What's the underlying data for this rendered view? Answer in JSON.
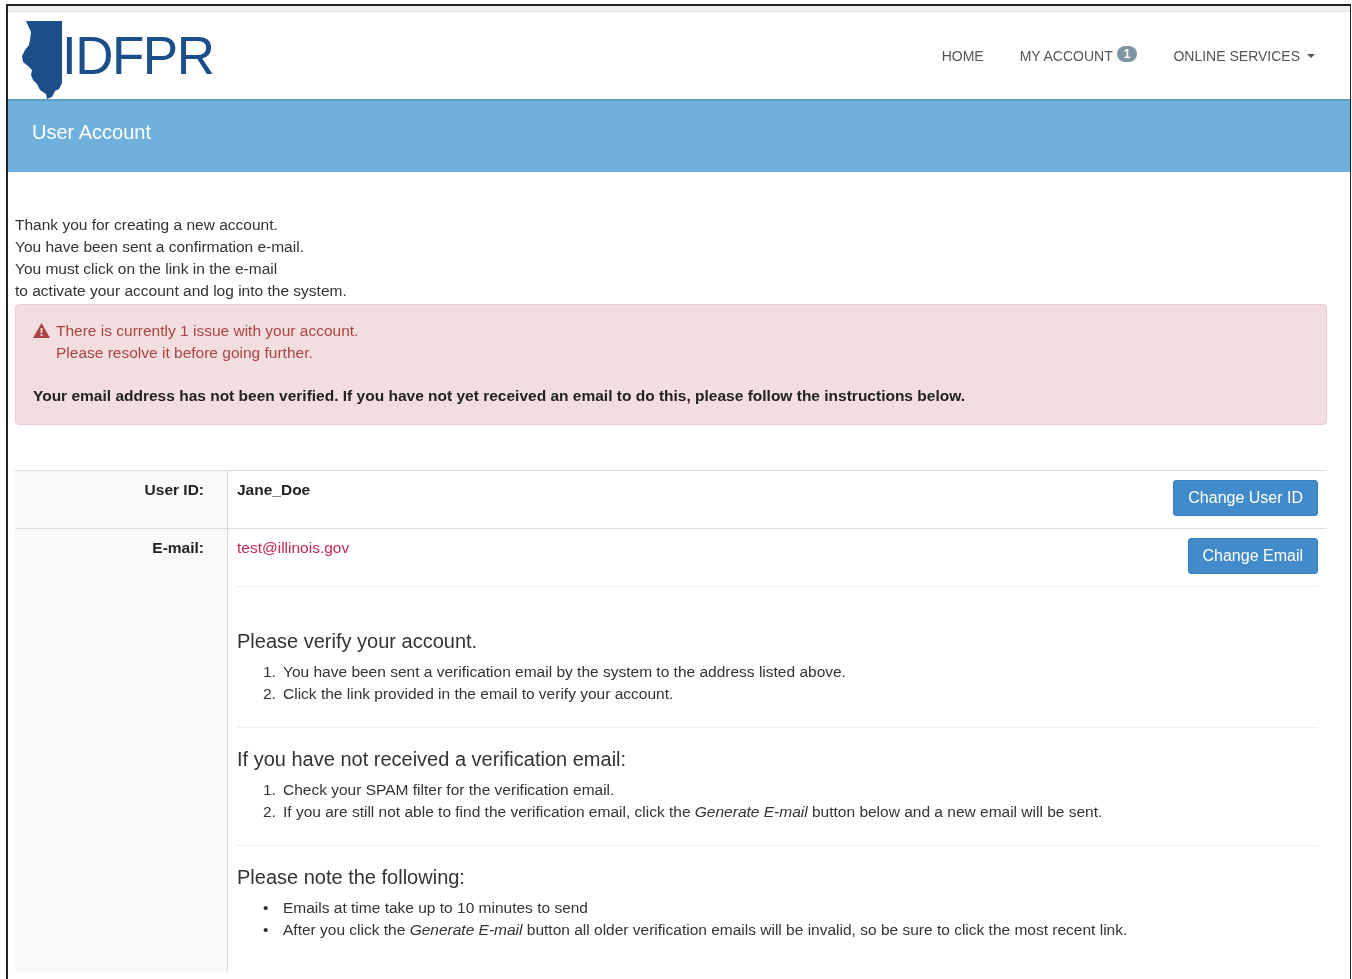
{
  "header": {
    "logo": "IDFPR",
    "nav": [
      {
        "label": "HOME",
        "kind": "link"
      },
      {
        "label": "MY ACCOUNT",
        "kind": "badge",
        "badge": "1"
      },
      {
        "label": "ONLINE SERVICES",
        "kind": "dropdown"
      }
    ]
  },
  "banner": {
    "title": "User Account"
  },
  "intro": [
    "Thank you for creating a new account.",
    "You have been sent a confirmation e-mail.",
    "You must click on the link in the e-mail",
    "to activate your account and log into the system."
  ],
  "alert": {
    "lines": [
      "There is currently 1 issue with your account.",
      "Please resolve it before going further."
    ],
    "message": "Your email address has not been verified. If you have not yet received an email to do this, please follow the instructions below."
  },
  "account": {
    "rows": [
      {
        "label": "User ID:",
        "value": "Jane_Doe",
        "kind": "text",
        "button": "Change User ID"
      },
      {
        "label": "E-mail:",
        "value": "test@illinois.gov",
        "kind": "email",
        "button": "Change Email"
      }
    ]
  },
  "sections": [
    {
      "heading": "Please verify your account.",
      "items": [
        {
          "marker": "1.",
          "text": "You have been sent a verification email by the system to the address listed above."
        },
        {
          "marker": "2.",
          "text": "Click the link provided in the email to verify your account."
        }
      ]
    },
    {
      "heading": "If you have not received a verification email:",
      "items": [
        {
          "marker": "1.",
          "text": "Check your SPAM filter for the verification email."
        },
        {
          "marker": "2.",
          "text": "If you are still not able to find the verification email, click the *Generate E-mail* button below and a new email will be sent."
        }
      ]
    },
    {
      "heading": "Please note the following:",
      "items": [
        {
          "marker": "•",
          "text": "Emails at time take up to 10 minutes to send"
        },
        {
          "marker": "•",
          "text": "After you click the *Generate E-mail* button all older verification emails will be invalid, so be sure to click the most recent link."
        }
      ]
    }
  ]
}
